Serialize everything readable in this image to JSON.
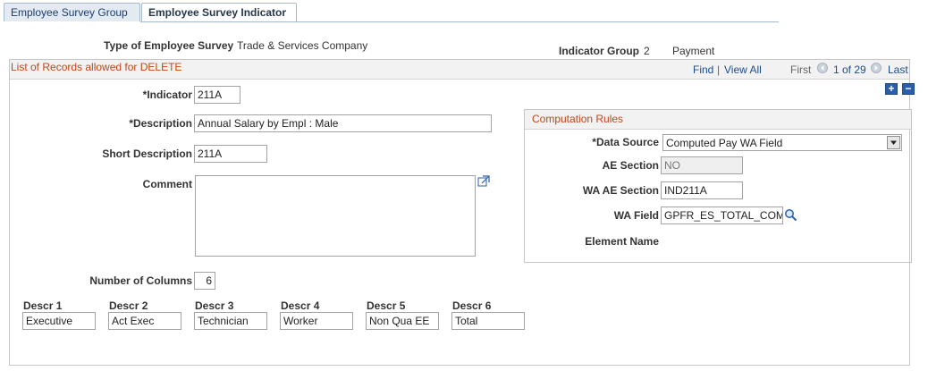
{
  "tabs": [
    {
      "label": "Employee Survey Group"
    },
    {
      "label": "Employee Survey Indicator"
    }
  ],
  "header": {
    "survey_type_label": "Type of Employee Survey",
    "survey_type_value": "Trade & Services Company",
    "indicator_group_label": "Indicator Group",
    "indicator_group_number": "2",
    "indicator_group_value": "Payment"
  },
  "grid": {
    "title": "List of Records allowed for DELETE",
    "find": "Find",
    "separator": "|",
    "view_all": "View All",
    "first": "First",
    "page_status": "1 of 29",
    "last": "Last",
    "add_button": "+",
    "delete_button": "−"
  },
  "form": {
    "indicator_label": "*Indicator",
    "indicator_value": "211A",
    "description_label": "*Description",
    "description_value": "Annual Salary by Empl : Male",
    "short_desc_label": "Short Description",
    "short_desc_value": "211A",
    "comment_label": "Comment",
    "comment_value": "",
    "num_columns_label": "Number of Columns",
    "num_columns_value": "6"
  },
  "computation": {
    "title": "Computation Rules",
    "data_source_label": "*Data Source",
    "data_source_value": "Computed Pay WA Field",
    "ae_section_label": "AE Section",
    "ae_section_value": "NO",
    "wa_ae_section_label": "WA AE Section",
    "wa_ae_section_value": "IND211A",
    "wa_field_label": "WA Field",
    "wa_field_value": "GPFR_ES_TOTAL_COM",
    "element_name_label": "Element Name"
  },
  "descr": [
    {
      "label": "Descr 1",
      "value": "Executive"
    },
    {
      "label": "Descr 2",
      "value": "Act Exec"
    },
    {
      "label": "Descr 3",
      "value": "Technician"
    },
    {
      "label": "Descr 4",
      "value": "Worker"
    },
    {
      "label": "Descr 5",
      "value": "Non Qua EE"
    },
    {
      "label": "Descr 6",
      "value": "Total"
    }
  ]
}
